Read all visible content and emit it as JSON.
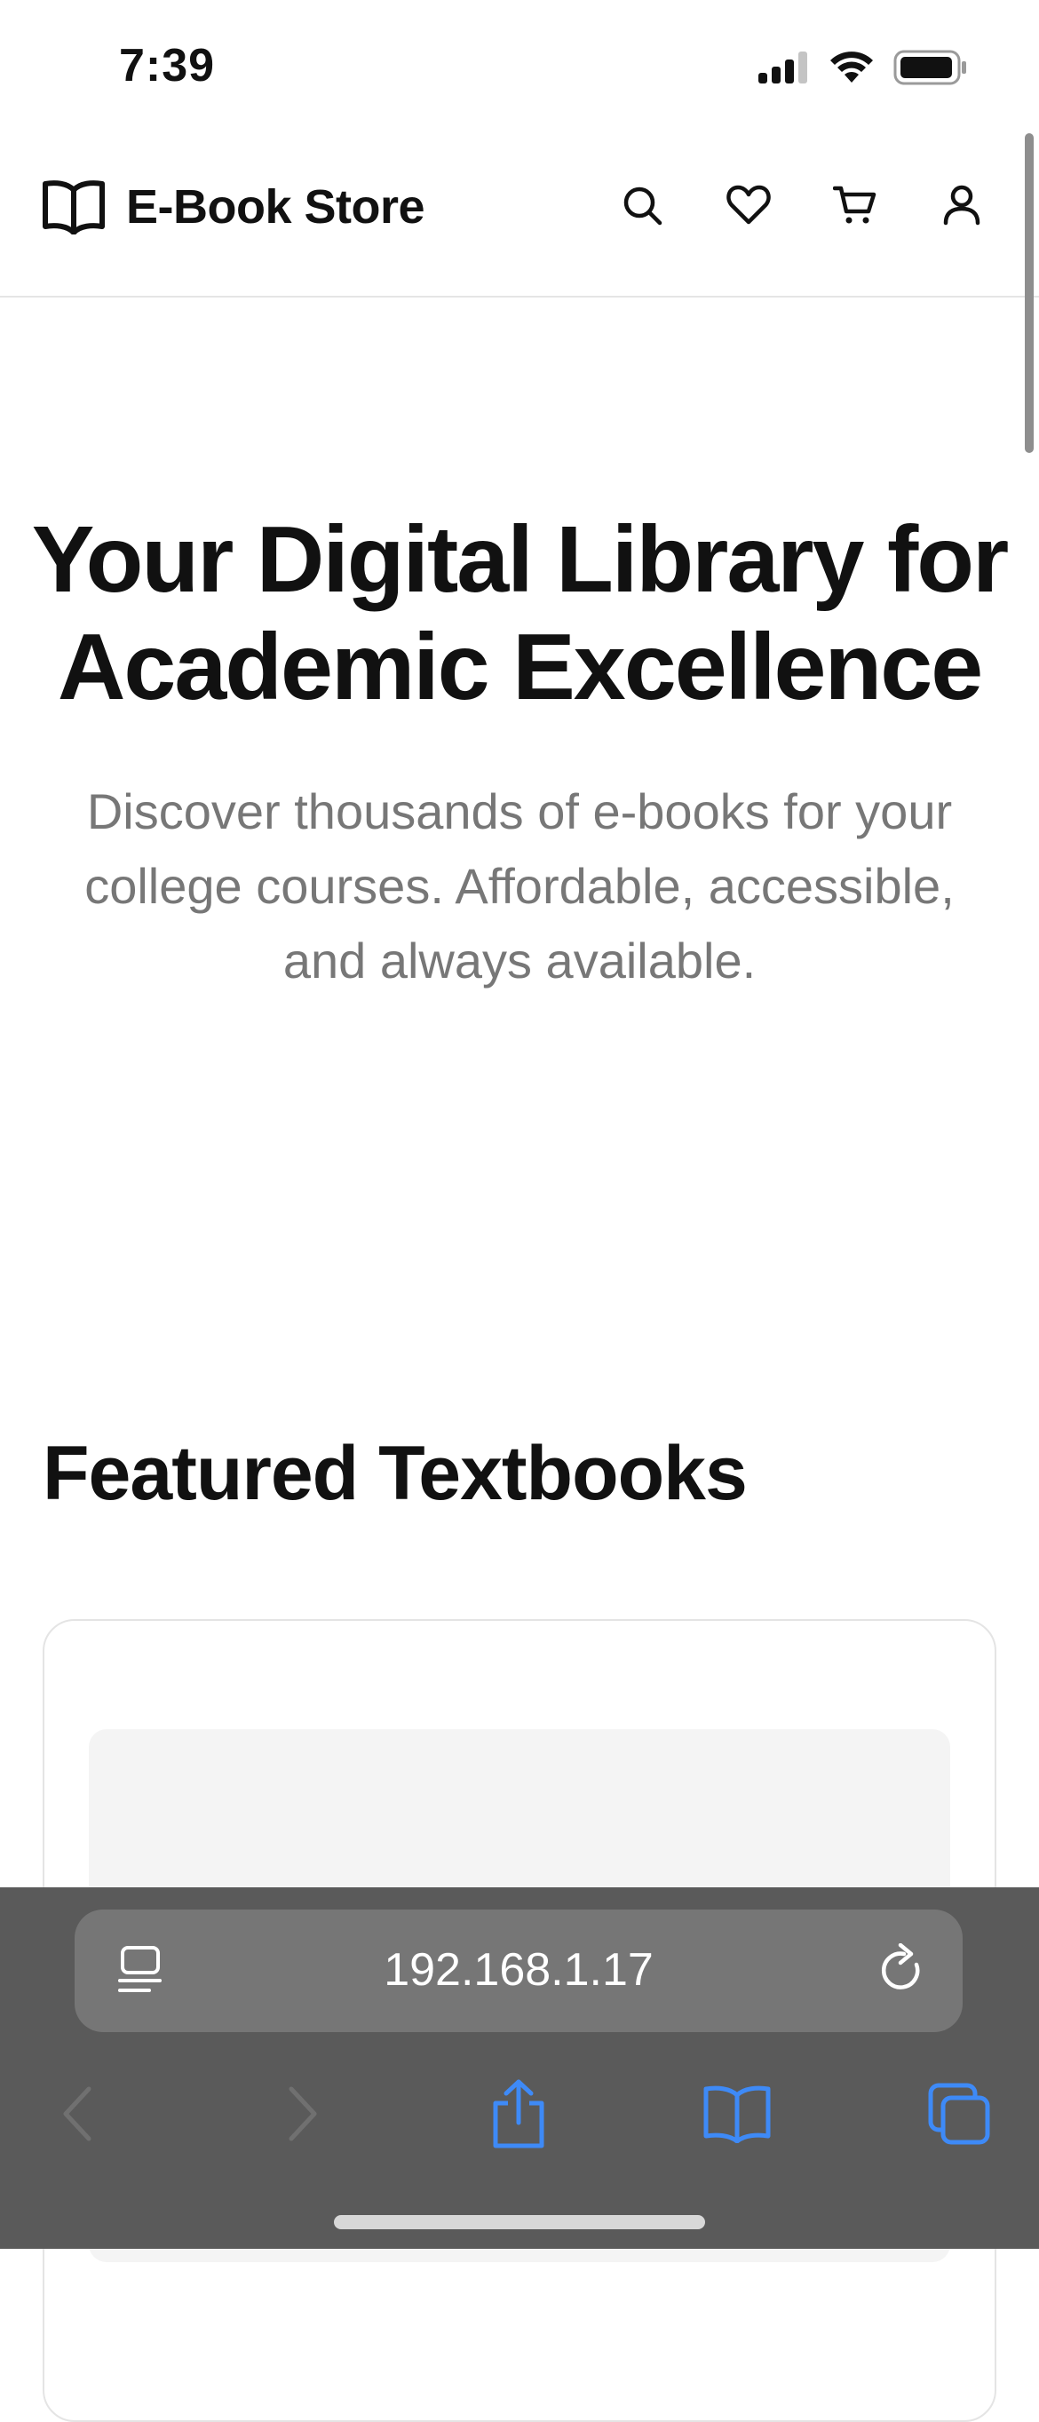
{
  "status_bar": {
    "time": "7:39"
  },
  "header": {
    "brand_name": "E-Book Store"
  },
  "hero": {
    "title": "Your Digital Library for Academic Excellence",
    "subtitle": "Discover thousands of e-books for your college courses. Affordable, accessible, and always available."
  },
  "featured": {
    "title": "Featured Textbooks"
  },
  "browser": {
    "url": "192.168.1.17"
  },
  "icons": {
    "brand": "open-book-icon",
    "search": "search-icon",
    "wishlist": "heart-icon",
    "cart": "cart-icon",
    "account": "user-icon"
  },
  "colors": {
    "safari_accent": "#3e8af7",
    "toolbar_bg": "#5a5a5a",
    "subtitle_gray": "#777777"
  }
}
